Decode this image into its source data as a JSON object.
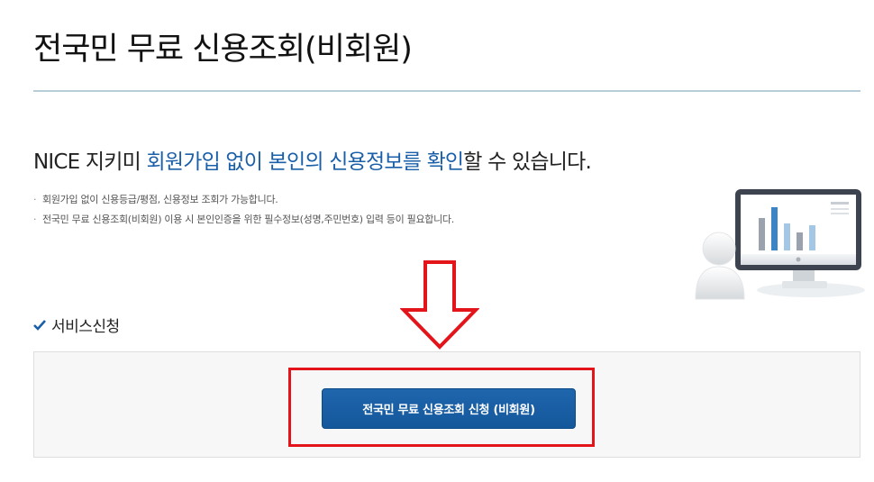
{
  "header": {
    "title": "전국민 무료 신용조회(비회원)"
  },
  "intro": {
    "headline_prefix": "NICE 지키미 ",
    "headline_highlight_1": "회원가입 없이 본인의 신용정보를 확인",
    "headline_suffix": "할 수 있습니다.",
    "notes": [
      "회원가입 없이 신용등급/평점, 신용정보 조회가 가능합니다.",
      "전국민 무료 신용조회(비회원) 이용 시 본인인증을 위한 필수정보(성명,주민번호) 입력 등이 필요합니다."
    ],
    "bullet": "·"
  },
  "service": {
    "section_title": "서비스신청",
    "apply_button_label": "전국민 무료 신용조회 신청 (비회원)"
  },
  "colors": {
    "accent_blue": "#1a5fa8",
    "button_blue": "#1f66ad",
    "annotation_red": "#e3151b"
  },
  "icons": {
    "section_check": "check-icon",
    "illustration": "monitor-chart-user-illustration",
    "annotation_arrow": "down-arrow-annotation"
  }
}
